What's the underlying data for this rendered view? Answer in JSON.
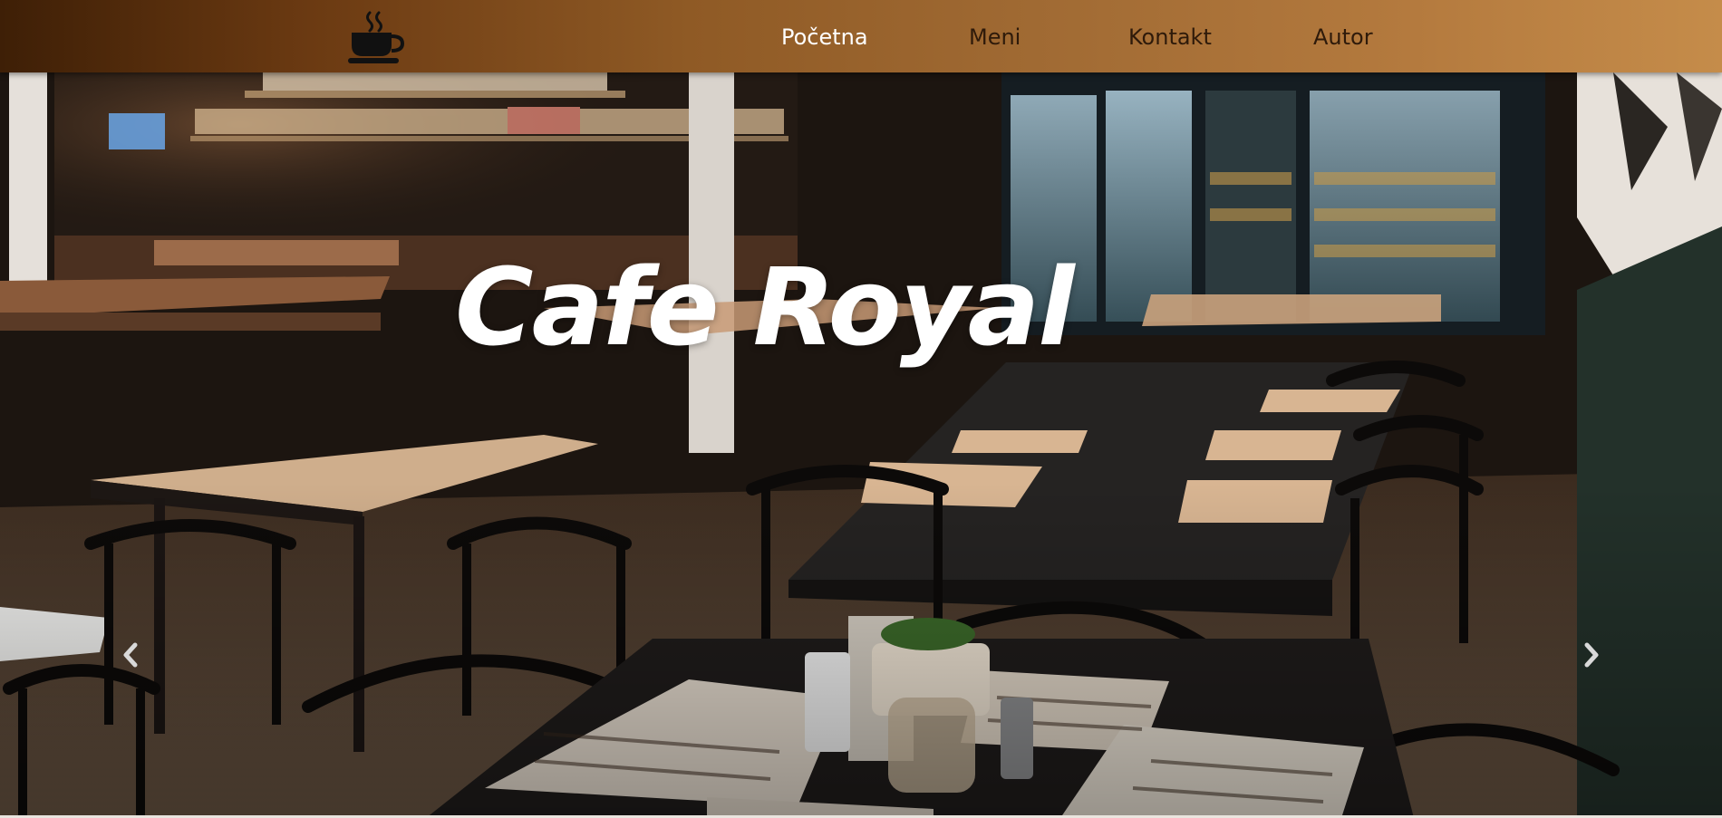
{
  "brand": {
    "logo_icon": "coffee-cup-icon"
  },
  "nav": {
    "items": [
      {
        "label": "Početna",
        "active": true
      },
      {
        "label": "Meni",
        "active": false
      },
      {
        "label": "Kontakt",
        "active": false
      },
      {
        "label": "Autor",
        "active": false
      }
    ]
  },
  "hero": {
    "title": "Cafe Royal",
    "prev_icon": "chevron-left-icon",
    "next_icon": "chevron-right-icon"
  },
  "colors": {
    "nav_gradient_start": "#3e1f06",
    "nav_gradient_end": "#c58c4a",
    "nav_active_text": "#ffffff",
    "nav_text": "#2e1a0a"
  }
}
